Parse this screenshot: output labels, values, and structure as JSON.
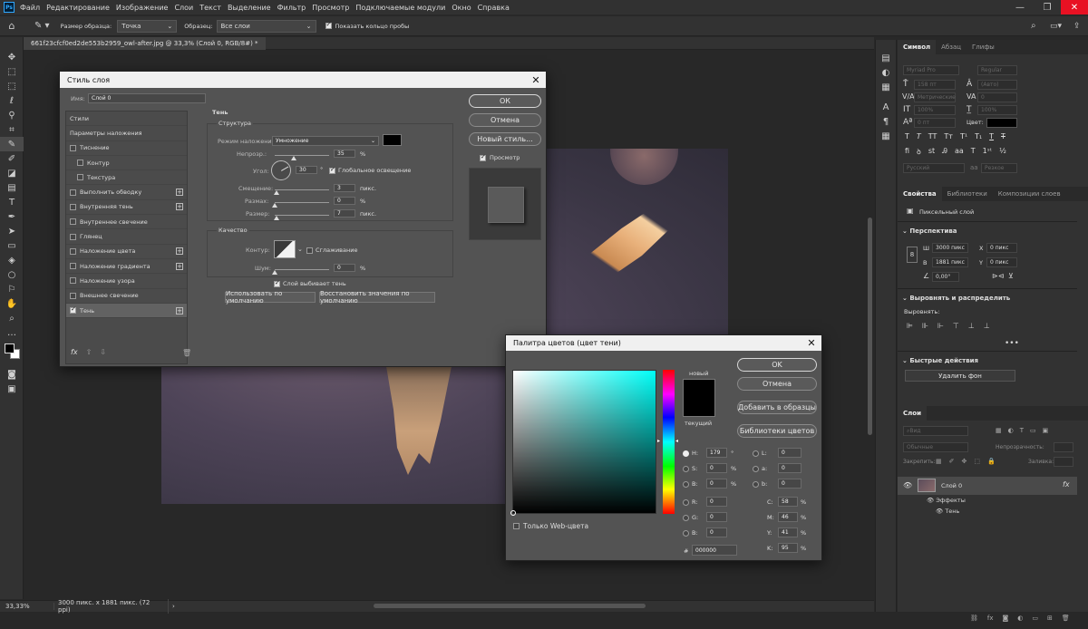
{
  "menu": {
    "app_icon": "Ps",
    "items": [
      "Файл",
      "Редактирование",
      "Изображение",
      "Слои",
      "Текст",
      "Выделение",
      "Фильтр",
      "Просмотр",
      "Подключаемые модули",
      "Окно",
      "Справка"
    ]
  },
  "options_bar": {
    "sample_size_label": "Размер образца:",
    "sample_size_value": "Точка",
    "sample_label": "Образец:",
    "sample_value": "Все слои",
    "show_ring_label": "Показать кольцо пробы"
  },
  "document_tab": "661f23cfcf0ed2de553b2959_owl-after.jpg @ 33,3% (Слой 0, RGB/8#) *",
  "status": {
    "zoom": "33,33%",
    "info": "3000 пикс. x 1881 пикс. (72 ppi)"
  },
  "layer_style": {
    "title": "Стиль слоя",
    "name_label": "Имя:",
    "name_value": "Слой 0",
    "list": [
      {
        "label": "Стили",
        "plus": false,
        "cb": false,
        "check": false
      },
      {
        "label": "Параметры наложения",
        "plus": false,
        "cb": false,
        "check": false
      },
      {
        "label": "Тиснение",
        "plus": false,
        "cb": true,
        "check": false
      },
      {
        "label": "Контур",
        "plus": false,
        "cb": true,
        "check": false,
        "indent": true
      },
      {
        "label": "Текстура",
        "plus": false,
        "cb": true,
        "check": false,
        "indent": true
      },
      {
        "label": "Выполнить обводку",
        "plus": true,
        "cb": true,
        "check": false
      },
      {
        "label": "Внутренняя тень",
        "plus": true,
        "cb": true,
        "check": false
      },
      {
        "label": "Внутреннее свечение",
        "plus": false,
        "cb": true,
        "check": false
      },
      {
        "label": "Глянец",
        "plus": false,
        "cb": true,
        "check": false
      },
      {
        "label": "Наложение цвета",
        "plus": true,
        "cb": true,
        "check": false
      },
      {
        "label": "Наложение градиента",
        "plus": true,
        "cb": true,
        "check": false
      },
      {
        "label": "Наложение узора",
        "plus": false,
        "cb": true,
        "check": false
      },
      {
        "label": "Внешнее свечение",
        "plus": false,
        "cb": true,
        "check": false
      },
      {
        "label": "Тень",
        "plus": true,
        "cb": true,
        "check": true,
        "active": true
      }
    ],
    "fx_label": "fx",
    "section_title": "Тень",
    "structure_title": "Структура",
    "blend_mode_label": "Режим наложения:",
    "blend_mode_value": "Умножение",
    "opacity_label": "Непрозр.:",
    "opacity_value": "35",
    "opacity_fraction": 0.35,
    "percent": "%",
    "angle_label": "Угол:",
    "angle_value": "30",
    "degree": "°",
    "global_light_label": "Глобальное освещение",
    "distance_label": "Смещение:",
    "distance_value": "3",
    "distance_fraction": 0.03,
    "spread_label": "Размах:",
    "spread_value": "0",
    "spread_fraction": 0,
    "size_label": "Размер:",
    "size_value": "7",
    "size_fraction": 0.03,
    "px_unit": "пикс.",
    "quality_title": "Качество",
    "contour_label": "Контур:",
    "antialias_label": "Сглаживание",
    "noise_label": "Шум:",
    "noise_value": "0",
    "noise_fraction": 0,
    "knockout_label": "Слой выбивает тень",
    "default_btn": "Использовать по умолчанию",
    "reset_btn": "Восстановить значения по умолчанию",
    "ok": "ОК",
    "cancel": "Отмена",
    "new_style": "Новый стиль...",
    "preview_label": "Просмотр",
    "shadow_color": "#000000"
  },
  "color_picker": {
    "title": "Палитра цветов (цвет тени)",
    "new_label": "новый",
    "current_label": "текущий",
    "ok": "OK",
    "cancel": "Отмена",
    "add_swatch": "Добавить в образцы",
    "libraries": "Библиотеки цветов",
    "web_only": "Только Web-цвета",
    "h_label": "H:",
    "h_value": "179",
    "h_unit": "°",
    "s_label": "S:",
    "s_value": "0",
    "s_unit": "%",
    "b_label": "B:",
    "b_value": "0",
    "b_unit": "%",
    "r_label": "R:",
    "r_value": "0",
    "g_label": "G:",
    "g_value": "0",
    "bl_label": "B:",
    "bl_value": "0",
    "l_label": "L:",
    "l_value": "0",
    "a_label": "a:",
    "a_value": "0",
    "b2_label": "b:",
    "b2_value": "0",
    "c_label": "C:",
    "c_value": "58",
    "c_unit": "%",
    "m_label": "M:",
    "m_value": "46",
    "m_unit": "%",
    "y_label": "Y:",
    "y_value": "41",
    "y_unit": "%",
    "k_label": "K:",
    "k_value": "95",
    "k_unit": "%",
    "hex_label": "#",
    "hex_value": "000000",
    "hue_color": "#00fff8"
  },
  "right_panel": {
    "char_tabs": [
      "Символ",
      "Абзац",
      "Глифы"
    ],
    "font_family": "Myriad Pro",
    "font_style": "Regular",
    "font_size": "158 пт",
    "leading": "(Авто)",
    "kerning": "Метрические",
    "tracking": "0",
    "vscale": "100%",
    "hscale": "100%",
    "baseline": "0 пт",
    "color_label": "Цвет:",
    "lang": "Русский",
    "aa": "Резкое",
    "props_tabs": [
      "Свойства",
      "Библиотеки",
      "Композиции слоев"
    ],
    "pixel_layer": "Пиксельный слой",
    "perspective": "Перспектива",
    "w_label": "Ш",
    "w_value": "3000 пикс",
    "h_label": "В",
    "h_value": "1881 пикс",
    "x_label": "X",
    "x_value": "0 пикс",
    "y_label": "Y",
    "y_value": "0 пикс",
    "angle_value": "0,00°",
    "align_title": "Выровнять и распределить",
    "align_label": "Выровнять:",
    "quick_actions": "Быстрые действия",
    "remove_bg": "Удалить фон",
    "layers_tab": "Слои",
    "layer_search": "Вид",
    "blend_mode": "Обычные",
    "opacity_label": "Непрозрачность:",
    "lock_label": "Закрепить:",
    "fill_label": "Заливка:",
    "layer_name": "Слой 0",
    "effects_label": "Эффекты",
    "shadow_label": "Тень",
    "fx": "fx"
  }
}
